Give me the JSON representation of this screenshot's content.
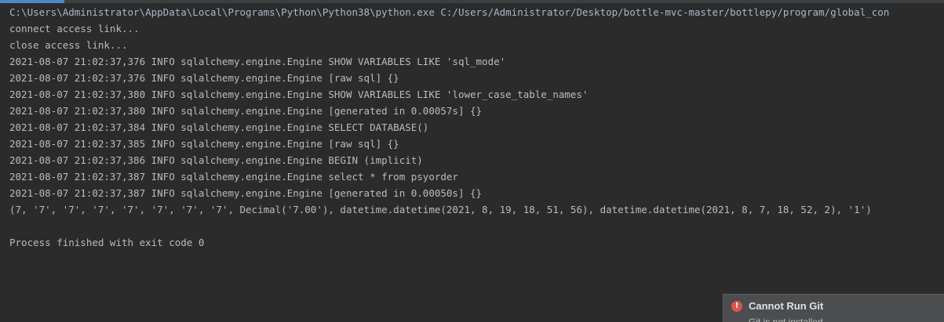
{
  "console": {
    "lines": [
      "C:\\Users\\Administrator\\AppData\\Local\\Programs\\Python\\Python38\\python.exe C:/Users/Administrator/Desktop/bottle-mvc-master/bottlepy/program/global_con",
      "connect access link...",
      "close access link...",
      "2021-08-07 21:02:37,376 INFO sqlalchemy.engine.Engine SHOW VARIABLES LIKE 'sql_mode'",
      "2021-08-07 21:02:37,376 INFO sqlalchemy.engine.Engine [raw sql] {}",
      "2021-08-07 21:02:37,380 INFO sqlalchemy.engine.Engine SHOW VARIABLES LIKE 'lower_case_table_names'",
      "2021-08-07 21:02:37,380 INFO sqlalchemy.engine.Engine [generated in 0.00057s] {}",
      "2021-08-07 21:02:37,384 INFO sqlalchemy.engine.Engine SELECT DATABASE()",
      "2021-08-07 21:02:37,385 INFO sqlalchemy.engine.Engine [raw sql] {}",
      "2021-08-07 21:02:37,386 INFO sqlalchemy.engine.Engine BEGIN (implicit)",
      "2021-08-07 21:02:37,387 INFO sqlalchemy.engine.Engine select * from psyorder",
      "2021-08-07 21:02:37,387 INFO sqlalchemy.engine.Engine [generated in 0.00050s] {}",
      "(7, '7', '7', '7', '7', '7', '7', '7', Decimal('7.00'), datetime.datetime(2021, 8, 19, 18, 51, 56), datetime.datetime(2021, 8, 7, 18, 52, 2), '1')",
      "",
      "Process finished with exit code 0"
    ]
  },
  "notification": {
    "icon": "error-icon",
    "icon_glyph": "!",
    "title": "Cannot Run Git",
    "body": "Git is not installed"
  },
  "colors": {
    "background": "#2b2b2b",
    "text": "#bbbbbb",
    "command_text": "#a9b7c6",
    "notification_bg": "#4b4d4f",
    "error_red": "#d9534f",
    "accent": "#4a88c7"
  }
}
